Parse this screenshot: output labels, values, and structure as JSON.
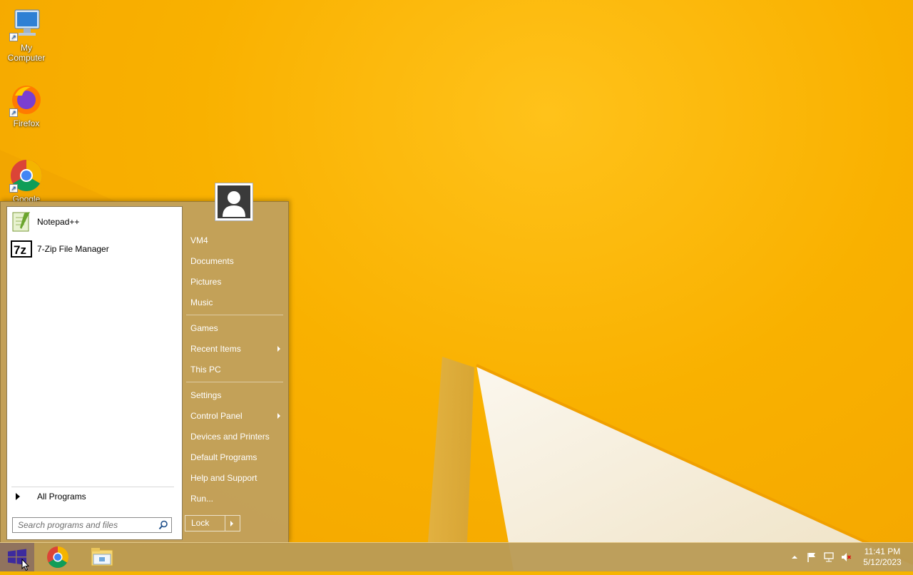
{
  "desktop": {
    "icons": [
      {
        "label": "My\nComputer",
        "icon": "computer-icon"
      },
      {
        "label": "Firefox",
        "icon": "firefox-icon"
      },
      {
        "label": "Google Chrome",
        "icon": "chrome-icon"
      }
    ]
  },
  "start_menu": {
    "pinned_programs": [
      {
        "label": "Notepad++",
        "icon": "notepadpp-icon"
      },
      {
        "label": "7-Zip File Manager",
        "icon": "7zip-icon"
      }
    ],
    "all_programs_label": "All Programs",
    "search": {
      "placeholder": "Search programs and files"
    },
    "right_pane": {
      "group1": [
        {
          "label": "VM4"
        },
        {
          "label": "Documents"
        },
        {
          "label": "Pictures"
        },
        {
          "label": "Music"
        }
      ],
      "group2": [
        {
          "label": "Games"
        },
        {
          "label": "Recent Items",
          "submenu": true
        },
        {
          "label": "This PC"
        }
      ],
      "group3": [
        {
          "label": "Settings"
        },
        {
          "label": "Control Panel",
          "submenu": true
        },
        {
          "label": "Devices and Printers"
        },
        {
          "label": "Default Programs"
        },
        {
          "label": "Help and Support"
        },
        {
          "label": "Run..."
        }
      ]
    },
    "power_button": {
      "label": "Lock"
    }
  },
  "taskbar": {
    "pinned": [
      "chrome-icon",
      "file-explorer-icon"
    ],
    "tray_icons": [
      "show-hidden-icons-icon",
      "action-center-flag-icon",
      "network-icon",
      "volume-muted-icon"
    ],
    "clock": {
      "time": "11:41 PM",
      "date": "5/12/2023"
    }
  }
}
